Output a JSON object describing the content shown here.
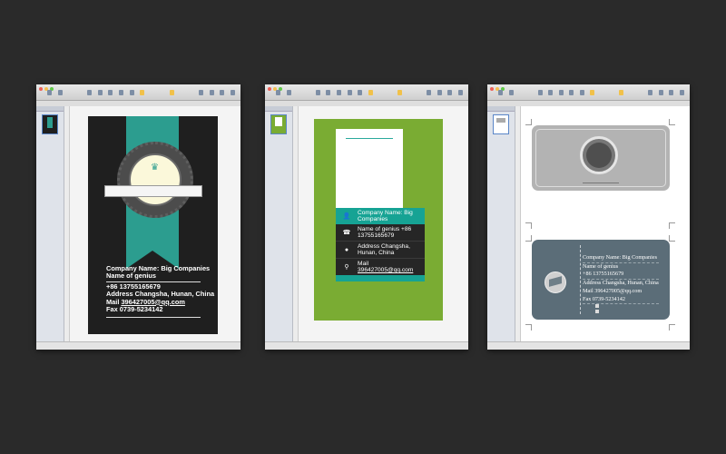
{
  "window1": {
    "info": [
      {
        "text": "Company Name: Big Companies"
      },
      {
        "text": "Name of genius"
      },
      {
        "text": "+86 13755165679"
      },
      {
        "text": "Address Changsha, Hunan, China"
      },
      {
        "label": "Mail ",
        "link": "396427005@qq.com"
      },
      {
        "text": "Fax 0739-5234142"
      }
    ]
  },
  "window2": {
    "rows": [
      {
        "icon": "user-icon",
        "glyph": "👤",
        "text": "Company Name: Big Companies"
      },
      {
        "icon": "phone-icon",
        "glyph": "☎",
        "text": "Name of genius +86 13755165679"
      },
      {
        "icon": "location-icon",
        "glyph": "●",
        "text": "Address Changsha, Hunan, China"
      },
      {
        "icon": "pin-icon",
        "glyph": "⚲",
        "text": "Mail",
        "link": "396427005@qq.com"
      }
    ]
  },
  "window3": {
    "info": [
      "Company Name: Big Companies",
      "Name of genius",
      "+86 13755165679",
      "Address Changsha, Hunan, China",
      "Mail 396427005@qq.com",
      "Fax 0739-5234142"
    ]
  },
  "colors": {
    "background": "#2a2a2a",
    "card1_bg": "#1f1f1f",
    "teal": "#2c9d8f",
    "card2_bg": "#7aac33",
    "card3_back": "#5b6d78"
  }
}
